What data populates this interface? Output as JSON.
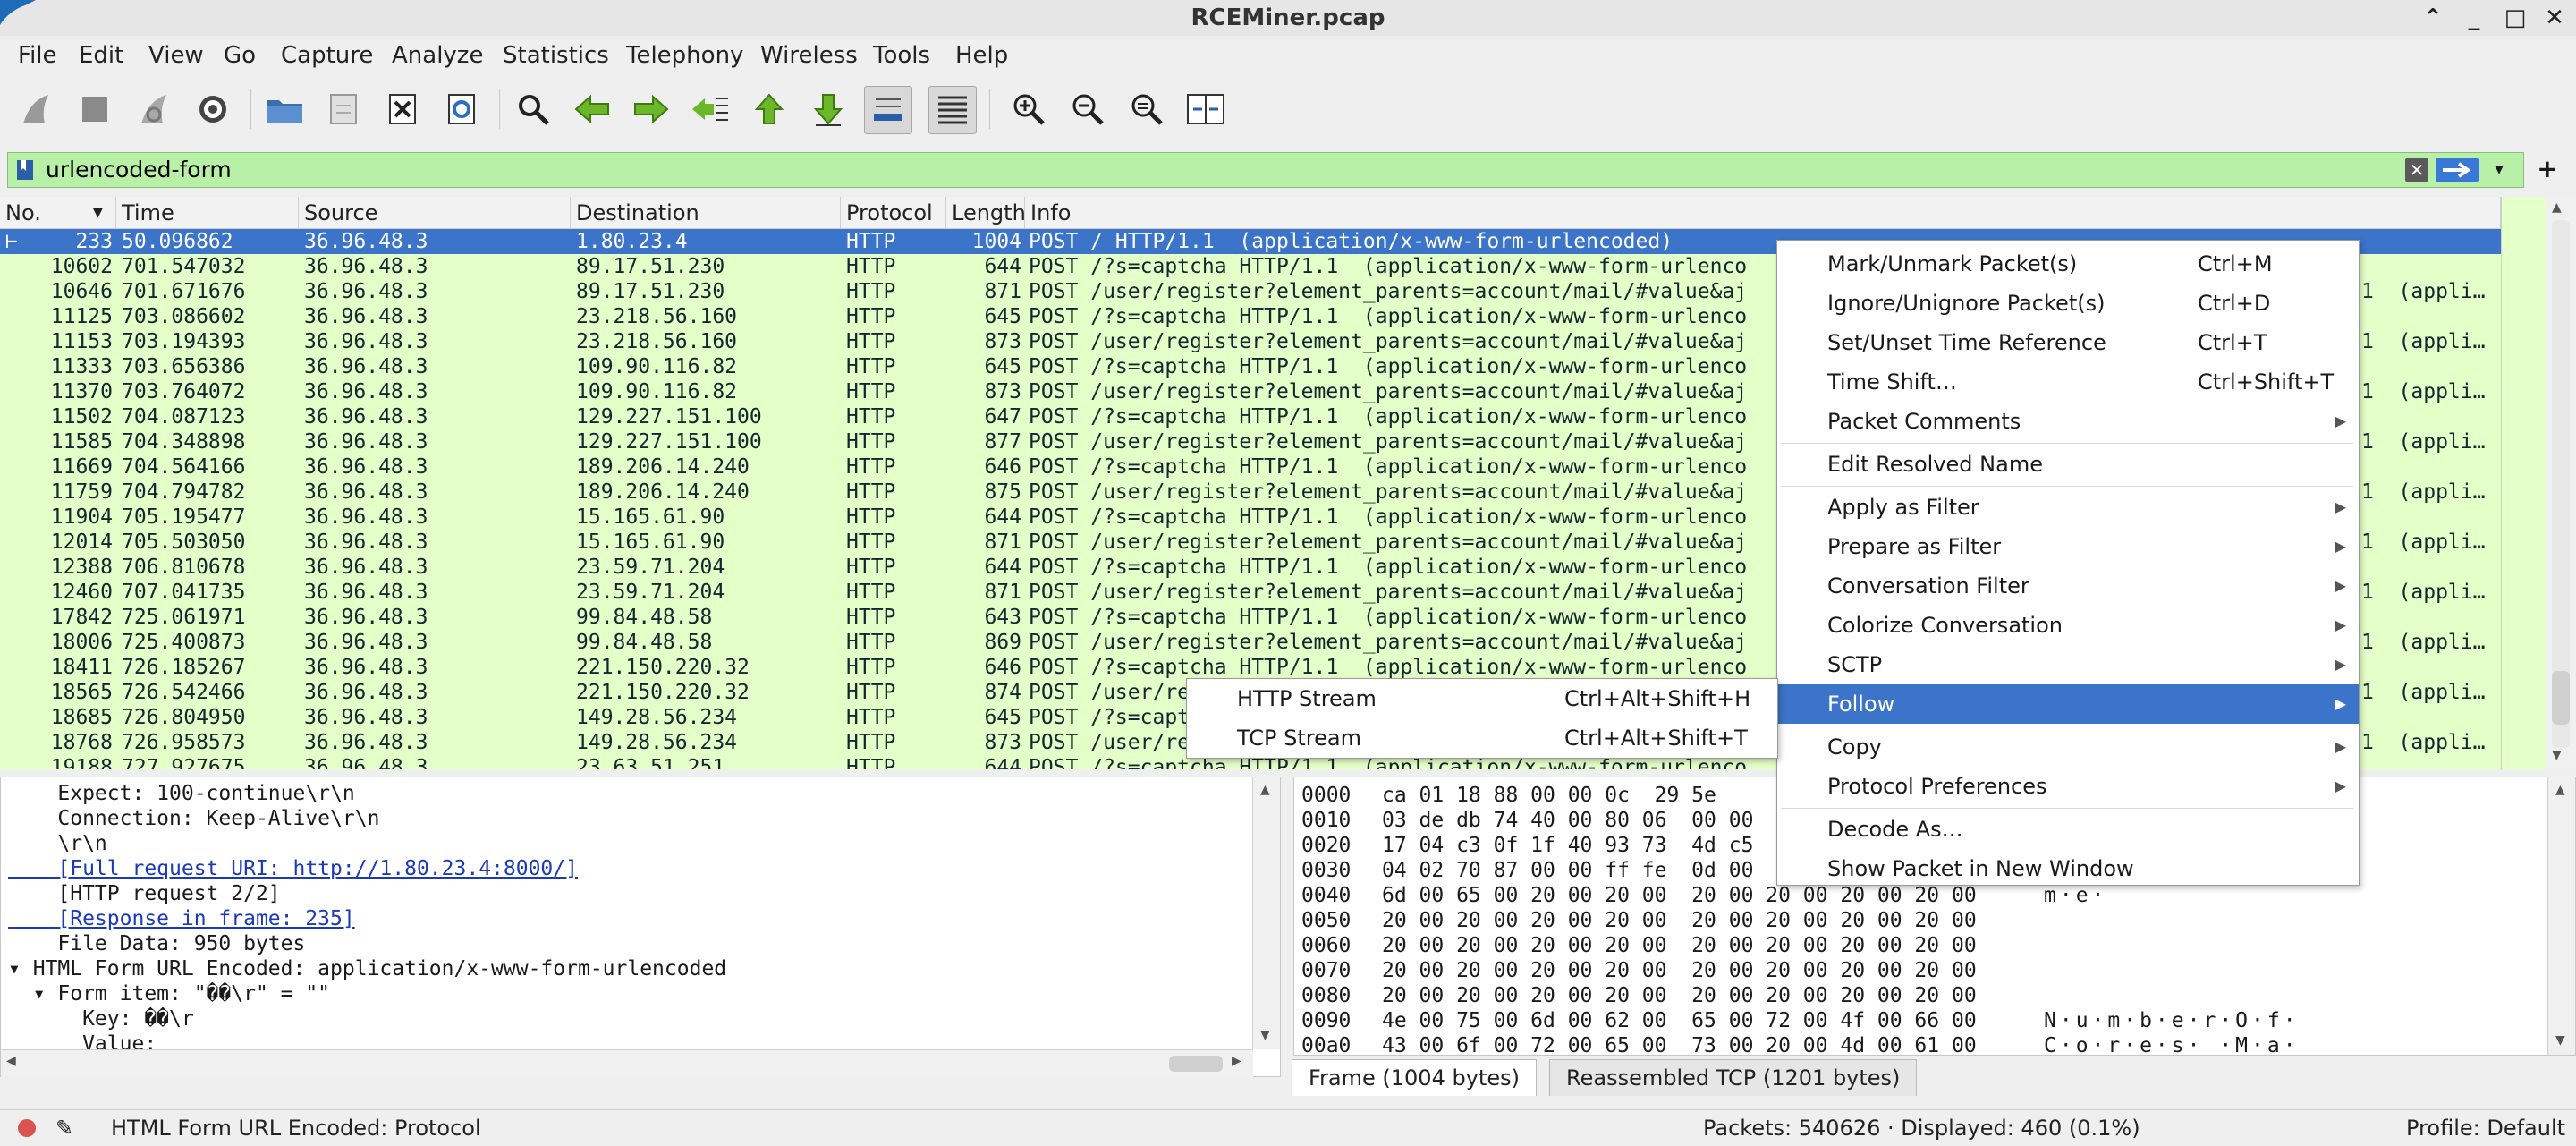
{
  "window": {
    "title": "RCEMiner.pcap"
  },
  "menubar": [
    "File",
    "Edit",
    "View",
    "Go",
    "Capture",
    "Analyze",
    "Statistics",
    "Telephony",
    "Wireless",
    "Tools",
    "Help"
  ],
  "filter": {
    "value": "urlencoded-form"
  },
  "columns": [
    "No.",
    "Time",
    "Source",
    "Destination",
    "Protocol",
    "Length",
    "Info"
  ],
  "packets": [
    {
      "no": "233",
      "time": "50.096862",
      "src": "36.96.48.3",
      "dst": "1.80.23.4",
      "proto": "HTTP",
      "len": "1004",
      "info": "POST / HTTP/1.1  (application/x-www-form-urlencoded)",
      "tail": ""
    },
    {
      "no": "10602",
      "time": "701.547032",
      "src": "36.96.48.3",
      "dst": "89.17.51.230",
      "proto": "HTTP",
      "len": "644",
      "info": "POST /?s=captcha HTTP/1.1  (application/x-www-form-urlenco",
      "tail": ""
    },
    {
      "no": "10646",
      "time": "701.671676",
      "src": "36.96.48.3",
      "dst": "89.17.51.230",
      "proto": "HTTP",
      "len": "871",
      "info": "POST /user/register?element_parents=account/mail/#value&aj",
      "tail": "1  (appli…"
    },
    {
      "no": "11125",
      "time": "703.086602",
      "src": "36.96.48.3",
      "dst": "23.218.56.160",
      "proto": "HTTP",
      "len": "645",
      "info": "POST /?s=captcha HTTP/1.1  (application/x-www-form-urlenco",
      "tail": ""
    },
    {
      "no": "11153",
      "time": "703.194393",
      "src": "36.96.48.3",
      "dst": "23.218.56.160",
      "proto": "HTTP",
      "len": "873",
      "info": "POST /user/register?element_parents=account/mail/#value&aj",
      "tail": "1  (appli…"
    },
    {
      "no": "11333",
      "time": "703.656386",
      "src": "36.96.48.3",
      "dst": "109.90.116.82",
      "proto": "HTTP",
      "len": "645",
      "info": "POST /?s=captcha HTTP/1.1  (application/x-www-form-urlenco",
      "tail": ""
    },
    {
      "no": "11370",
      "time": "703.764072",
      "src": "36.96.48.3",
      "dst": "109.90.116.82",
      "proto": "HTTP",
      "len": "873",
      "info": "POST /user/register?element_parents=account/mail/#value&aj",
      "tail": "1  (appli…"
    },
    {
      "no": "11502",
      "time": "704.087123",
      "src": "36.96.48.3",
      "dst": "129.227.151.100",
      "proto": "HTTP",
      "len": "647",
      "info": "POST /?s=captcha HTTP/1.1  (application/x-www-form-urlenco",
      "tail": ""
    },
    {
      "no": "11585",
      "time": "704.348898",
      "src": "36.96.48.3",
      "dst": "129.227.151.100",
      "proto": "HTTP",
      "len": "877",
      "info": "POST /user/register?element_parents=account/mail/#value&aj",
      "tail": "1  (appli…"
    },
    {
      "no": "11669",
      "time": "704.564166",
      "src": "36.96.48.3",
      "dst": "189.206.14.240",
      "proto": "HTTP",
      "len": "646",
      "info": "POST /?s=captcha HTTP/1.1  (application/x-www-form-urlenco",
      "tail": ""
    },
    {
      "no": "11759",
      "time": "704.794782",
      "src": "36.96.48.3",
      "dst": "189.206.14.240",
      "proto": "HTTP",
      "len": "875",
      "info": "POST /user/register?element_parents=account/mail/#value&aj",
      "tail": "1  (appli…"
    },
    {
      "no": "11904",
      "time": "705.195477",
      "src": "36.96.48.3",
      "dst": "15.165.61.90",
      "proto": "HTTP",
      "len": "644",
      "info": "POST /?s=captcha HTTP/1.1  (application/x-www-form-urlenco",
      "tail": ""
    },
    {
      "no": "12014",
      "time": "705.503050",
      "src": "36.96.48.3",
      "dst": "15.165.61.90",
      "proto": "HTTP",
      "len": "871",
      "info": "POST /user/register?element_parents=account/mail/#value&aj",
      "tail": "1  (appli…"
    },
    {
      "no": "12388",
      "time": "706.810678",
      "src": "36.96.48.3",
      "dst": "23.59.71.204",
      "proto": "HTTP",
      "len": "644",
      "info": "POST /?s=captcha HTTP/1.1  (application/x-www-form-urlenco",
      "tail": ""
    },
    {
      "no": "12460",
      "time": "707.041735",
      "src": "36.96.48.3",
      "dst": "23.59.71.204",
      "proto": "HTTP",
      "len": "871",
      "info": "POST /user/register?element_parents=account/mail/#value&aj",
      "tail": "1  (appli…"
    },
    {
      "no": "17842",
      "time": "725.061971",
      "src": "36.96.48.3",
      "dst": "99.84.48.58",
      "proto": "HTTP",
      "len": "643",
      "info": "POST /?s=captcha HTTP/1.1  (application/x-www-form-urlenco",
      "tail": ""
    },
    {
      "no": "18006",
      "time": "725.400873",
      "src": "36.96.48.3",
      "dst": "99.84.48.58",
      "proto": "HTTP",
      "len": "869",
      "info": "POST /user/register?element_parents=account/mail/#value&aj",
      "tail": "1  (appli…"
    },
    {
      "no": "18411",
      "time": "726.185267",
      "src": "36.96.48.3",
      "dst": "221.150.220.32",
      "proto": "HTTP",
      "len": "646",
      "info": "POST /?s=captcha HTTP/1.1  (application/x-www-form-urlenco",
      "tail": ""
    },
    {
      "no": "18565",
      "time": "726.542466",
      "src": "36.96.48.3",
      "dst": "221.150.220.32",
      "proto": "HTTP",
      "len": "874",
      "info": "POST /user/re",
      "tail": "1  (appli…"
    },
    {
      "no": "18685",
      "time": "726.804950",
      "src": "36.96.48.3",
      "dst": "149.28.56.234",
      "proto": "HTTP",
      "len": "645",
      "info": "POST /?s=capt",
      "tail": ""
    },
    {
      "no": "18768",
      "time": "726.958573",
      "src": "36.96.48.3",
      "dst": "149.28.56.234",
      "proto": "HTTP",
      "len": "873",
      "info": "POST /user/re",
      "tail": "1  (appli…"
    },
    {
      "no": "19188",
      "time": "727.927675",
      "src": "36.96.48.3",
      "dst": "23.63.51.251",
      "proto": "HTTP",
      "len": "644",
      "info": "POST /?s=captcha HTTP/1.1  (application/x-www-form-urlenco",
      "tail": ""
    }
  ],
  "details": [
    {
      "text": "    Expect: 100-continue\\r\\n",
      "link": false
    },
    {
      "text": "    Connection: Keep-Alive\\r\\n",
      "link": false
    },
    {
      "text": "    \\r\\n",
      "link": false
    },
    {
      "text": "    [Full request URI: http://1.80.23.4:8000/]",
      "link": true
    },
    {
      "text": "    [HTTP request 2/2]",
      "link": false
    },
    {
      "text": "    [Response in frame: 235]",
      "link": true
    },
    {
      "text": "    File Data: 950 bytes",
      "link": false
    },
    {
      "text": "▾ HTML Form URL Encoded: application/x-www-form-urlencoded",
      "link": false
    },
    {
      "text": "  ▾ Form item: \"��\\r\" = \"\"",
      "link": false
    },
    {
      "text": "      Key: ��\\r",
      "link": false
    },
    {
      "text": "      Value:",
      "link": false
    }
  ],
  "bytes": [
    {
      "off": "0000",
      "hex": "ca 01 18 88 00 00 0c  29 5e",
      "ascii": ""
    },
    {
      "off": "0010",
      "hex": "03 de db 74 40 00 80 06  00 00",
      "ascii": ""
    },
    {
      "off": "0020",
      "hex": "17 04 c3 0f 1f 40 93 73  4d c5",
      "ascii": ""
    },
    {
      "off": "0030",
      "hex": "04 02 70 87 00 00 ff fe  0d 00",
      "ascii": ""
    },
    {
      "off": "0040",
      "hex": "6d 00 65 00 20 00 20 00  20 00 20 00 20 00 20 00",
      "ascii": "m·e·"
    },
    {
      "off": "0050",
      "hex": "20 00 20 00 20 00 20 00  20 00 20 00 20 00 20 00",
      "ascii": ""
    },
    {
      "off": "0060",
      "hex": "20 00 20 00 20 00 20 00  20 00 20 00 20 00 20 00",
      "ascii": ""
    },
    {
      "off": "0070",
      "hex": "20 00 20 00 20 00 20 00  20 00 20 00 20 00 20 00",
      "ascii": ""
    },
    {
      "off": "0080",
      "hex": "20 00 20 00 20 00 20 00  20 00 20 00 20 00 20 00",
      "ascii": ""
    },
    {
      "off": "0090",
      "hex": "4e 00 75 00 6d 00 62 00  65 00 72 00 4f 00 66 00",
      "ascii": "N·u·m·b·e·r·O·f·"
    },
    {
      "off": "00a0",
      "hex": "43 00 6f 00 72 00 65 00  73 00 20 00 4d 00 61 00",
      "ascii": "C·o·r·e·s· ·M·a·"
    }
  ],
  "bytes_tabs": [
    "Frame (1004 bytes)",
    "Reassembled TCP (1201 bytes)"
  ],
  "status": {
    "left": "HTML Form URL Encoded: Protocol",
    "packets": "Packets: 540626 · Displayed: 460 (0.1%)",
    "profile": "Profile: Default"
  },
  "context_menu": [
    {
      "label": "Mark/Unmark Packet(s)",
      "shortcut": "Ctrl+M",
      "submenu": false
    },
    {
      "label": "Ignore/Unignore Packet(s)",
      "shortcut": "Ctrl+D",
      "submenu": false
    },
    {
      "label": "Set/Unset Time Reference",
      "shortcut": "Ctrl+T",
      "submenu": false
    },
    {
      "label": "Time Shift…",
      "shortcut": "Ctrl+Shift+T",
      "submenu": false
    },
    {
      "label": "Packet Comments",
      "shortcut": "",
      "submenu": true
    },
    {
      "label": "Edit Resolved Name",
      "shortcut": "",
      "submenu": false
    },
    {
      "label": "Apply as Filter",
      "shortcut": "",
      "submenu": true
    },
    {
      "label": "Prepare as Filter",
      "shortcut": "",
      "submenu": true
    },
    {
      "label": "Conversation Filter",
      "shortcut": "",
      "submenu": true
    },
    {
      "label": "Colorize Conversation",
      "shortcut": "",
      "submenu": true
    },
    {
      "label": "SCTP",
      "shortcut": "",
      "submenu": true
    },
    {
      "label": "Follow",
      "shortcut": "",
      "submenu": true
    },
    {
      "label": "Copy",
      "shortcut": "",
      "submenu": true
    },
    {
      "label": "Protocol Preferences",
      "shortcut": "",
      "submenu": true
    },
    {
      "label": "Decode As…",
      "shortcut": "",
      "submenu": false
    },
    {
      "label": "Show Packet in New Window",
      "shortcut": "",
      "submenu": false
    }
  ],
  "follow_submenu": [
    {
      "label": "HTTP Stream",
      "shortcut": "Ctrl+Alt+Shift+H"
    },
    {
      "label": "TCP Stream",
      "shortcut": "Ctrl+Alt+Shift+T"
    }
  ],
  "colors": {
    "row_bg": "#e4ffc7",
    "selected": "#3b74c8",
    "filter_bg": "#b8f0a8",
    "link": "#1a3ab8"
  }
}
